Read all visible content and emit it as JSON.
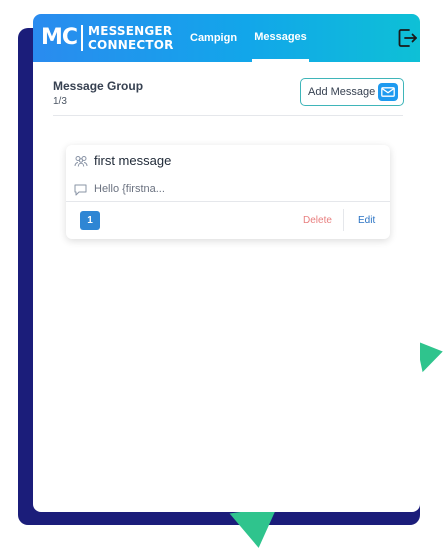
{
  "brand": {
    "logo_mark": "MC",
    "logo_line1": "MESSENGER",
    "logo_line2": "CONNECTOR"
  },
  "nav": {
    "tabs": [
      {
        "label": "Campign",
        "active": false
      },
      {
        "label": "Messages",
        "active": true
      }
    ],
    "logout_icon": "logout-icon"
  },
  "group": {
    "title": "Message Group",
    "count": "1/3"
  },
  "toolbar": {
    "add_message_label": "Add Message",
    "add_message_icon": "mail-icon"
  },
  "messages": [
    {
      "title": "first message",
      "preview": "Hello {firstna...",
      "index": "1",
      "delete_label": "Delete",
      "edit_label": "Edit"
    }
  ],
  "colors": {
    "header_gradient_start": "#2a8bef",
    "header_gradient_end": "#0ec0d6",
    "navy_background": "#1b1d7a",
    "accent_green": "#2fc48d",
    "badge": "#2f86d4",
    "delete": "#e87f7f",
    "edit": "#2a73c4"
  }
}
